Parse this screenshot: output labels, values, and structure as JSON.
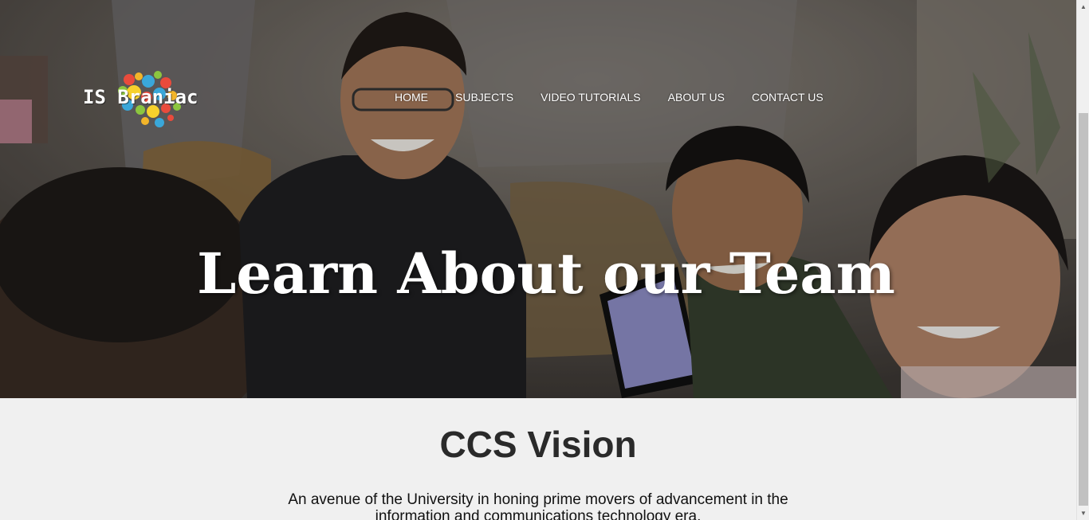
{
  "site": {
    "logo_text": "IS Braniac"
  },
  "nav": {
    "items": [
      "HOME",
      "SUBJECTS",
      "VIDEO TUTORIALS",
      "ABOUT US",
      "CONTACT US"
    ]
  },
  "hero": {
    "title": "Learn About our Team"
  },
  "vision": {
    "title": "CCS Vision",
    "text": "An avenue of the University in honing prime movers of advancement in the information and communications technology era."
  },
  "icons": {
    "scroll_up": "scroll-up-arrow-icon",
    "scroll_down": "scroll-down-arrow-icon"
  },
  "colors": {
    "hero_text": "#ffffff",
    "page_bg": "#f0f0f0",
    "heading": "#2a2a2a"
  }
}
